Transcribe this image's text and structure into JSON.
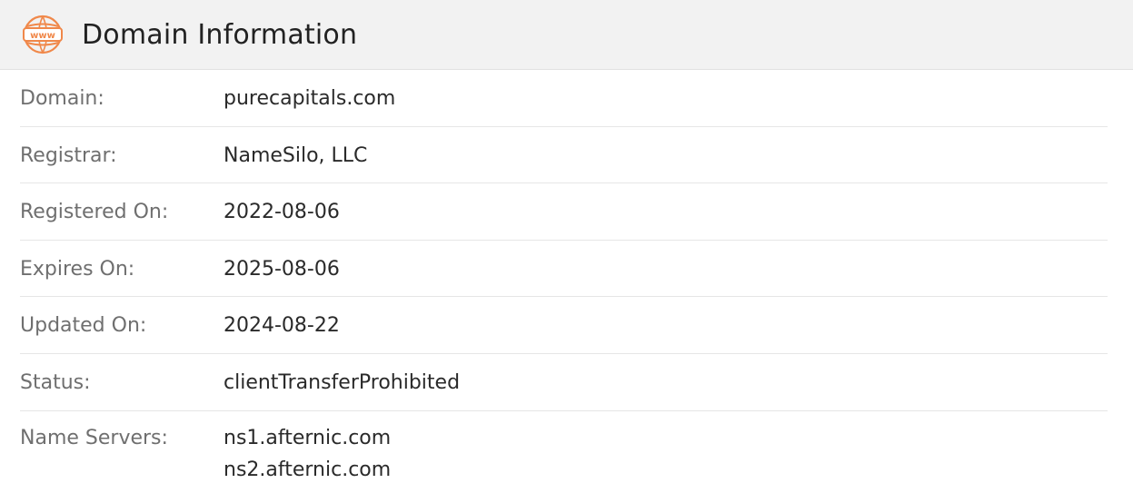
{
  "header": {
    "title": "Domain Information",
    "icon": "www-globe-icon",
    "icon_text": "www",
    "icon_color": "#f0884a"
  },
  "rows": [
    {
      "label": "Domain:",
      "value": "purecapitals.com"
    },
    {
      "label": "Registrar:",
      "value": "NameSilo, LLC"
    },
    {
      "label": "Registered On:",
      "value": "2022-08-06"
    },
    {
      "label": "Expires On:",
      "value": "2025-08-06"
    },
    {
      "label": "Updated On:",
      "value": "2024-08-22"
    },
    {
      "label": "Status:",
      "value": "clientTransferProhibited"
    }
  ],
  "name_servers": {
    "label": "Name Servers:",
    "values": [
      "ns1.afternic.com",
      "ns2.afternic.com"
    ]
  }
}
